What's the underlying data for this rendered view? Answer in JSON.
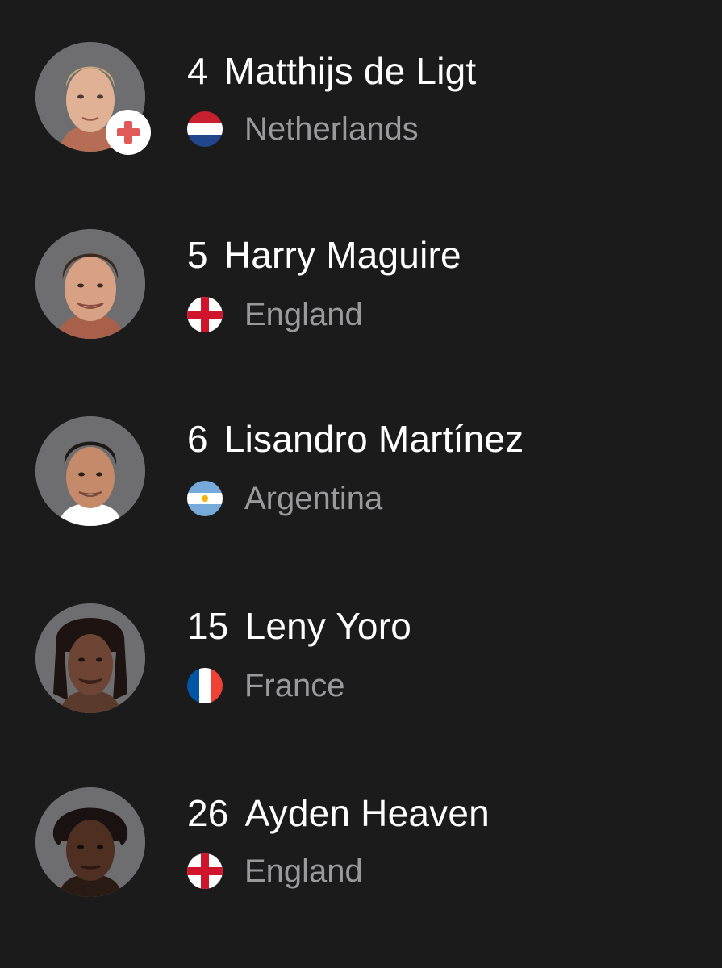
{
  "players": [
    {
      "number": "4",
      "name": "Matthijs de Ligt",
      "country": "Netherlands",
      "flag_icon": "netherlands-flag-icon",
      "has_injury_badge": true
    },
    {
      "number": "5",
      "name": "Harry Maguire",
      "country": "England",
      "flag_icon": "england-flag-icon",
      "has_injury_badge": false
    },
    {
      "number": "6",
      "name": "Lisandro Martínez",
      "country": "Argentina",
      "flag_icon": "argentina-flag-icon",
      "has_injury_badge": false
    },
    {
      "number": "15",
      "name": "Leny Yoro",
      "country": "France",
      "flag_icon": "france-flag-icon",
      "has_injury_badge": false
    },
    {
      "number": "26",
      "name": "Ayden Heaven",
      "country": "England",
      "flag_icon": "england-flag-icon",
      "has_injury_badge": false
    }
  ],
  "colors": {
    "background": "#1b1b1c",
    "name_text": "#ffffff",
    "country_text": "#9a9a9c",
    "injury_badge": "#e05a5a"
  }
}
